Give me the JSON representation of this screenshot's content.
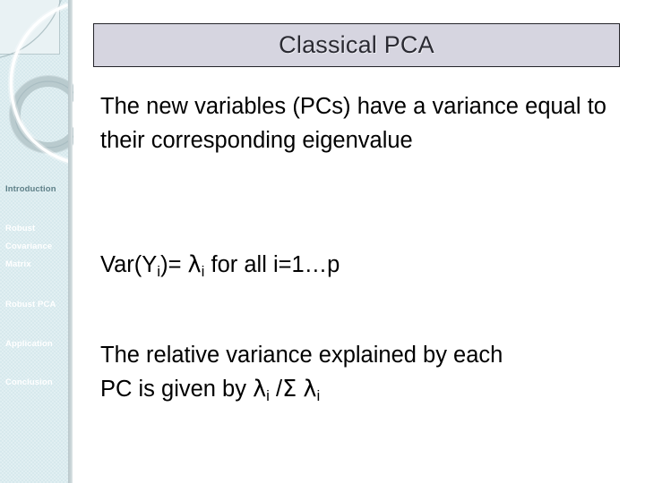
{
  "slide": {
    "title": "Classical PCA",
    "title_bg": "#d6d5e0",
    "title_border": "#24242a"
  },
  "sidebar": {
    "bg": "#d7e9ed",
    "active_color": "#5d7f87",
    "inactive_color": "#ffffff",
    "items": [
      {
        "label": "Introduction",
        "active": true
      },
      {
        "label": "Robust",
        "active": false
      },
      {
        "label": "Covariance",
        "active": false
      },
      {
        "label": "Matrix",
        "active": false
      },
      {
        "label": "Robust PCA",
        "active": false
      },
      {
        "label": "Application",
        "active": false
      },
      {
        "label": "Conclusion",
        "active": false
      }
    ]
  },
  "body": {
    "paragraph_1": "The new variables (PCs) have a variance equal to their corresponding eigenvalue",
    "formula": {
      "prefix": "Var(Y",
      "sub_1": "i",
      "middle": ")= ",
      "lambda": "λ",
      "sub_2": "i",
      "suffix": "  for all i=1…p"
    },
    "paragraph_2": {
      "line_1": "The relative variance explained by each",
      "line_2_prefix": "PC is given by ",
      "lambda_1": "λ",
      "sub_1": "i",
      "separator": " /",
      "sigma": "Σ",
      "space": " ",
      "lambda_2": "λ",
      "sub_2": "i"
    }
  }
}
